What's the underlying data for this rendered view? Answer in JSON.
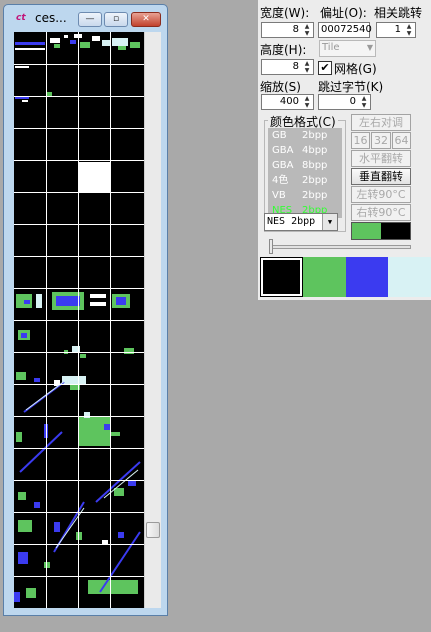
{
  "tile_window": {
    "title": "ces...",
    "icon_text": "ct",
    "buttons": {
      "minimize": "—",
      "maximize": "▫",
      "close": "✕"
    }
  },
  "params": {
    "width_label": "宽度(W):",
    "width_value": "8",
    "offset_label": "偏址(O):",
    "offset_value": "00072540",
    "jump_label": "相关跳转",
    "jump_value": "1",
    "height_label": "高度(H):",
    "height_value": "8",
    "tile_mode": "Tile",
    "grid_label": "网格(G)",
    "grid_checked": true,
    "zoom_label": "缩放(S)",
    "zoom_value": "400",
    "skip_label": "跳过字节(K)",
    "skip_value": "0"
  },
  "color_format": {
    "legend": "颜色格式(C)",
    "items": [
      {
        "name": "GB",
        "bpp": "2bpp"
      },
      {
        "name": "GBA",
        "bpp": "4bpp"
      },
      {
        "name": "GBA",
        "bpp": "8bpp"
      },
      {
        "name": "4色",
        "bpp": "2bpp"
      },
      {
        "name": "VB",
        "bpp": "2bpp"
      },
      {
        "name": "NES",
        "bpp": "2bpp"
      }
    ],
    "selected": "NES  2bpp"
  },
  "transform_buttons": {
    "mirror_lr": "左右对调",
    "size_16": "16",
    "size_32": "32",
    "size_64": "64",
    "flip_h": "水平翻转",
    "flip_v": "垂直翻转",
    "rotate_left": "左转90°C",
    "rotate_right": "右转90°C"
  },
  "palette": [
    "#000000",
    "#5ec45e",
    "#3b3bf0",
    "#d8f2f4"
  ],
  "palette_selected": [
    "#5ec45e",
    "#000000"
  ]
}
